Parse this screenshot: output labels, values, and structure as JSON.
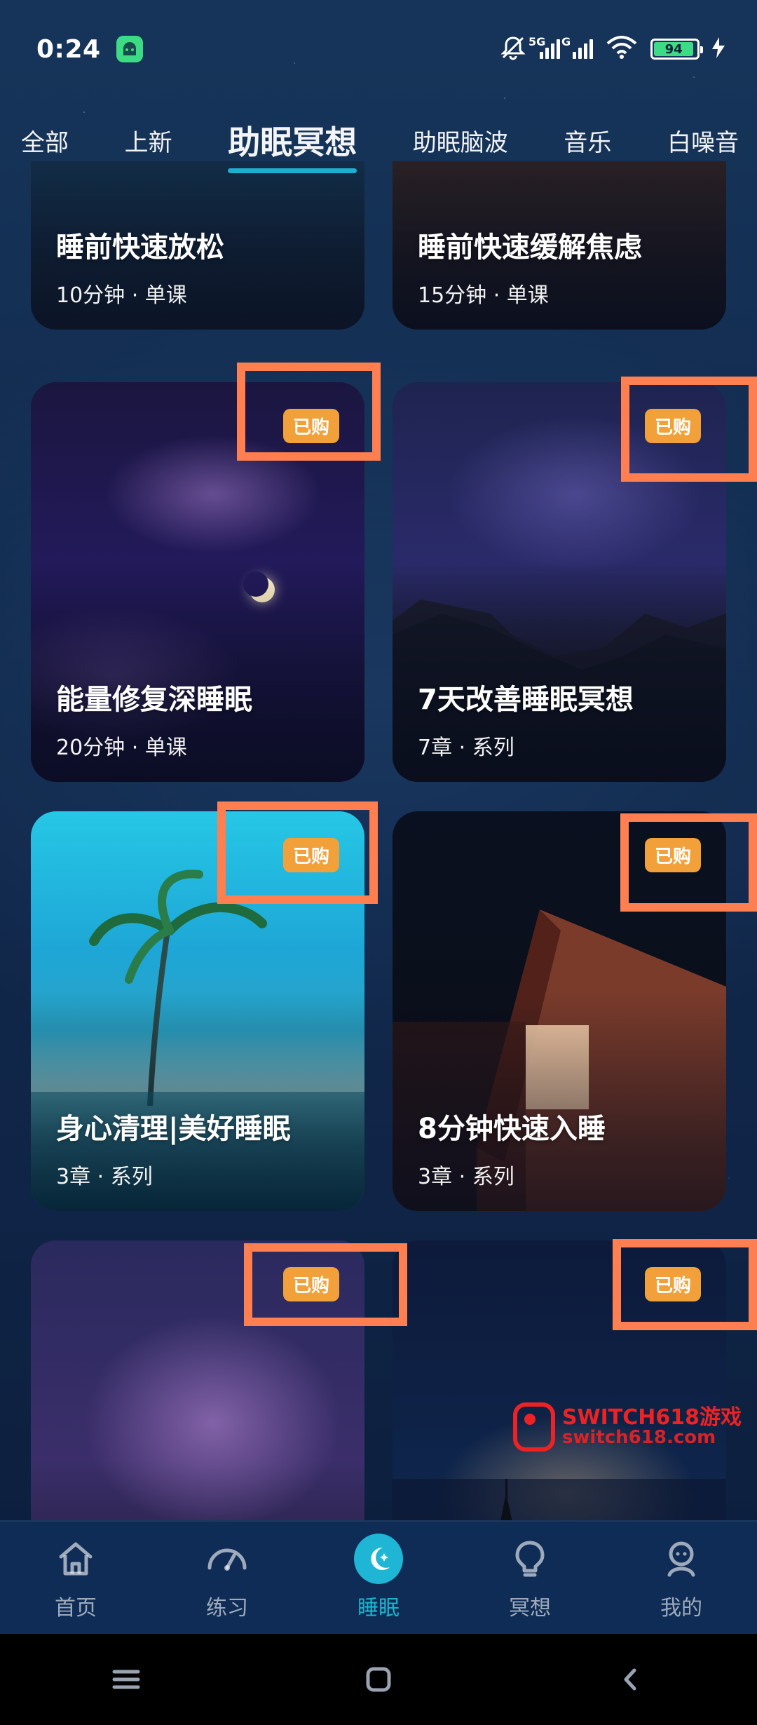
{
  "status_bar": {
    "time": "0:24",
    "network_1": "5G",
    "network_2": "G",
    "battery_level": "94",
    "battery_percent": 94
  },
  "tabs": [
    {
      "label": "全部",
      "active": false
    },
    {
      "label": "上新",
      "active": false
    },
    {
      "label": "助眠冥想",
      "active": true
    },
    {
      "label": "助眠脑波",
      "active": false
    },
    {
      "label": "音乐",
      "active": false
    },
    {
      "label": "白噪音",
      "active": false
    }
  ],
  "cards": [
    {
      "title": "睡前快速放松",
      "meta": "10分钟 · 单课",
      "badge": ""
    },
    {
      "title": "睡前快速缓解焦虑",
      "meta": "15分钟 · 单课",
      "badge": ""
    },
    {
      "title": "能量修复深睡眠",
      "meta": "20分钟 · 单课",
      "badge": "已购"
    },
    {
      "title": "7天改善睡眠冥想",
      "meta": "7章 · 系列",
      "badge": "已购"
    },
    {
      "title": "身心清理|美好睡眠",
      "meta": "3章 · 系列",
      "badge": "已购"
    },
    {
      "title": "8分钟快速入睡",
      "meta": "3章 · 系列",
      "badge": "已购"
    },
    {
      "title": "",
      "meta": "",
      "badge": "已购"
    },
    {
      "title": "",
      "meta": "",
      "badge": "已购"
    }
  ],
  "watermark": {
    "line1": "SWITCH618游戏",
    "line2": "switch618.com"
  },
  "bottom_nav": [
    {
      "label": "首页",
      "icon": "home-icon",
      "active": false
    },
    {
      "label": "练习",
      "icon": "gauge-icon",
      "active": false
    },
    {
      "label": "睡眠",
      "icon": "moon-icon",
      "active": true
    },
    {
      "label": "冥想",
      "icon": "bulb-icon",
      "active": false
    },
    {
      "label": "我的",
      "icon": "profile-icon",
      "active": false
    }
  ],
  "colors": {
    "accent": "#1fb6d6",
    "badge": "#f2a13a",
    "highlight": "#ff7f50",
    "nav_bg": "#0e2c55"
  }
}
